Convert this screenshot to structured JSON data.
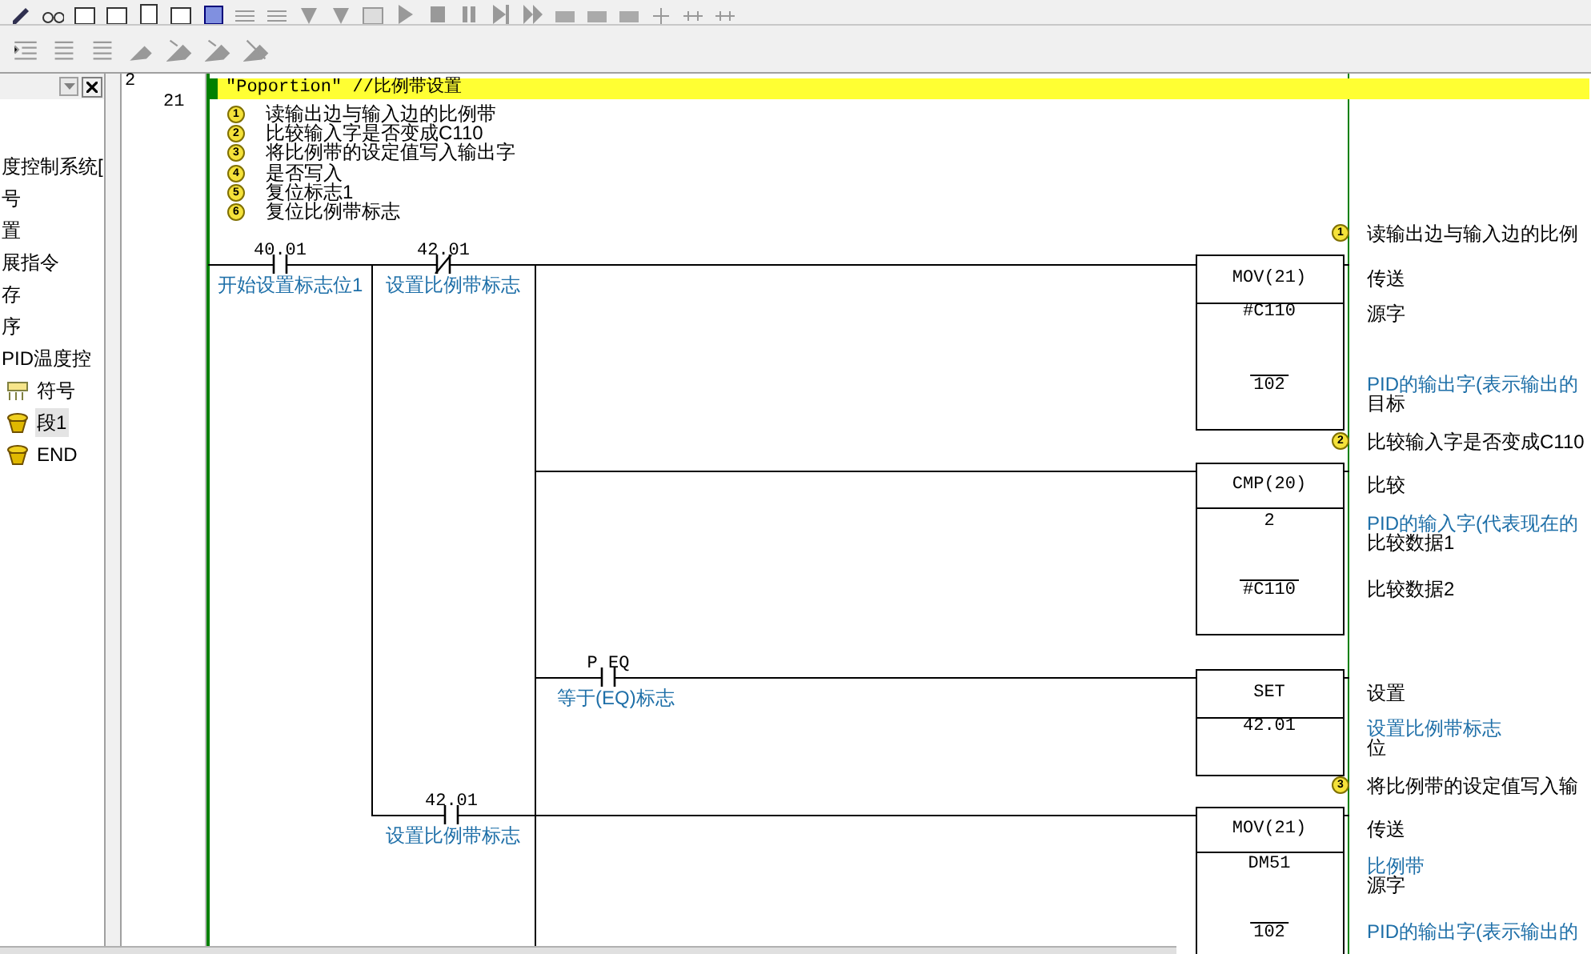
{
  "tree": {
    "items": [
      {
        "kind": "text",
        "label": "度控制系统[",
        "selected": false
      },
      {
        "kind": "text",
        "label": "号",
        "selected": false
      },
      {
        "kind": "text",
        "label": "置",
        "selected": false
      },
      {
        "kind": "text",
        "label": "展指令",
        "selected": false
      },
      {
        "kind": "text",
        "label": "存",
        "selected": false
      },
      {
        "kind": "text",
        "label": "序",
        "selected": false
      },
      {
        "kind": "text",
        "label": "PID温度控",
        "selected": false
      },
      {
        "kind": "symbols",
        "label": "符号",
        "selected": false
      },
      {
        "kind": "section",
        "label": "段1",
        "selected": true
      },
      {
        "kind": "section",
        "label": "END",
        "selected": false
      }
    ]
  },
  "line_numbers": {
    "section": "2",
    "rung": "21"
  },
  "rung": {
    "comment": "\"Poportion\" //比例带设置",
    "notes": [
      {
        "marker": "1",
        "text": "读输出边与输入边的比例带"
      },
      {
        "marker": "2",
        "text": "比较输入字是否变成C110"
      },
      {
        "marker": "3",
        "text": "将比例带的设定值写入输出字"
      },
      {
        "marker": "4",
        "text": "是否写入"
      },
      {
        "marker": "5",
        "text": "复位标志1"
      },
      {
        "marker": "6",
        "text": "复位比例带标志"
      }
    ],
    "contacts": [
      {
        "kind": "no",
        "address": "40.01",
        "comment": "开始设置标志位1"
      },
      {
        "kind": "nc",
        "address": "42.01",
        "comment": "设置比例带标志"
      },
      {
        "kind": "no",
        "address": "P_EQ",
        "comment": "等于(EQ)标志"
      },
      {
        "kind": "no",
        "address": "42.01",
        "comment": "设置比例带标志"
      }
    ],
    "instructions": [
      {
        "mnemonic": "MOV(21)",
        "marker": "1",
        "title": "读输出边与输入边的比例",
        "description": "传送",
        "operands": [
          {
            "value": "#C110",
            "overline": false,
            "label": "源字"
          },
          {
            "value": "102",
            "overline": true,
            "comment": "PID的输出字(表示输出的",
            "label": "目标"
          }
        ]
      },
      {
        "mnemonic": "CMP(20)",
        "marker": "2",
        "title": "比较输入字是否变成C110",
        "description": "比较",
        "operands": [
          {
            "value": "2",
            "overline": false,
            "comment": "PID的输入字(代表现在的",
            "label": "比较数据1"
          },
          {
            "value": "#C110",
            "overline": true,
            "label": "比较数据2"
          }
        ]
      },
      {
        "mnemonic": "SET",
        "description": "设置",
        "operands": [
          {
            "value": "42.01",
            "overline": false,
            "comment": "设置比例带标志",
            "label": "位"
          }
        ]
      },
      {
        "mnemonic": "MOV(21)",
        "marker": "3",
        "title": "将比例带的设定值写入输",
        "description": "传送",
        "operands": [
          {
            "value": "DM51",
            "overline": false,
            "comment": "比例带",
            "label": "源字"
          },
          {
            "value": "102",
            "overline": true,
            "comment": "PID的输出字(表示输出的"
          }
        ]
      }
    ]
  }
}
